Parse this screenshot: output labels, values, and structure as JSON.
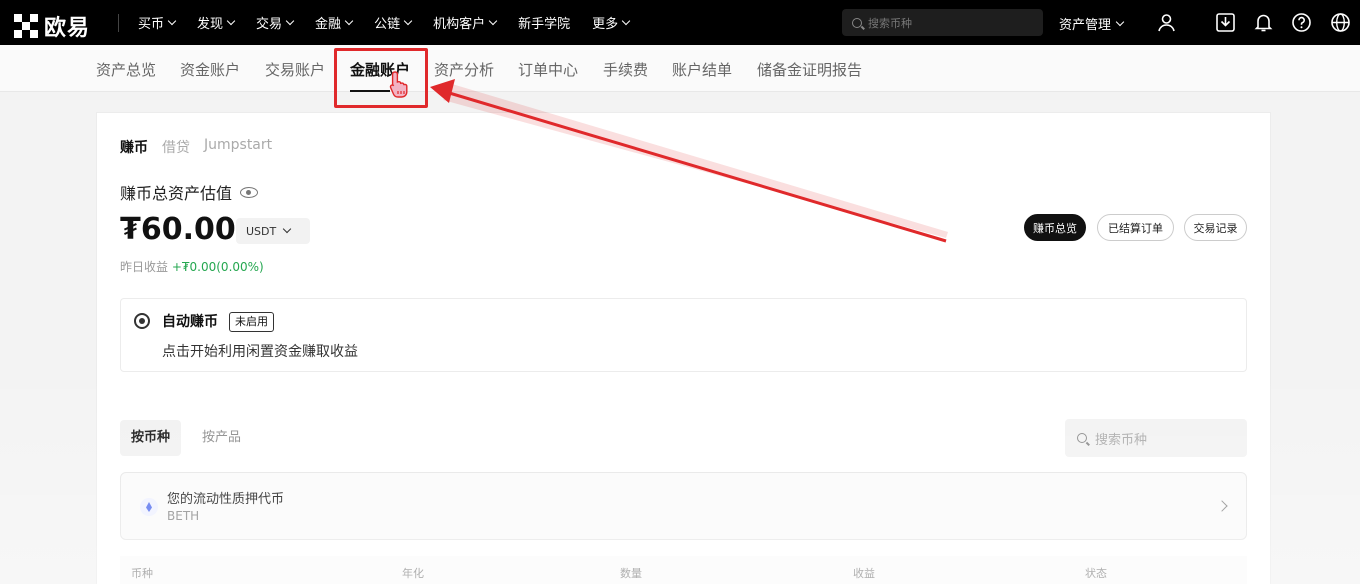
{
  "brand": {
    "name": "欧易"
  },
  "nav": {
    "items": [
      {
        "label": "买币",
        "dropdown": true
      },
      {
        "label": "发现",
        "dropdown": true
      },
      {
        "label": "交易",
        "dropdown": true
      },
      {
        "label": "金融",
        "dropdown": true
      },
      {
        "label": "公链",
        "dropdown": true
      },
      {
        "label": "机构客户",
        "dropdown": true
      },
      {
        "label": "新手学院",
        "dropdown": false
      },
      {
        "label": "更多",
        "dropdown": true
      }
    ],
    "search_placeholder": "搜索币种",
    "asset_management": "资产管理",
    "icons": [
      "user-icon",
      "download-icon",
      "bell-icon",
      "help-icon",
      "globe-icon"
    ]
  },
  "subnav": {
    "tabs": [
      "资产总览",
      "资金账户",
      "交易账户",
      "金融账户",
      "资产分析",
      "订单中心",
      "手续费",
      "账户结单",
      "储备金证明报告"
    ],
    "active": "金融账户"
  },
  "earn": {
    "tabs": [
      "赚币",
      "借贷",
      "Jumpstart"
    ],
    "active_tab": "赚币",
    "total_label": "赚币总资产估值",
    "amount": "₮60.00",
    "currency": "USDT",
    "yesterday_label": "昨日收益",
    "yesterday_value": "+₮0.00(0.00%)",
    "actions": [
      "赚币总览",
      "已结算订单",
      "交易记录"
    ]
  },
  "auto_earn": {
    "title": "自动赚币",
    "badge": "未启用",
    "description": "点击开始利用闲置资金赚取收益"
  },
  "holdings": {
    "view_tabs": [
      "按币种",
      "按产品"
    ],
    "search_placeholder": "搜索币种",
    "product": {
      "name": "您的流动性质押代币",
      "sub": "BETH"
    },
    "columns": [
      "币种",
      "年化",
      "数量",
      "收益",
      "状态"
    ]
  },
  "colors": {
    "highlight": "#e0292b",
    "positive": "#25a750",
    "dark": "#111111"
  }
}
